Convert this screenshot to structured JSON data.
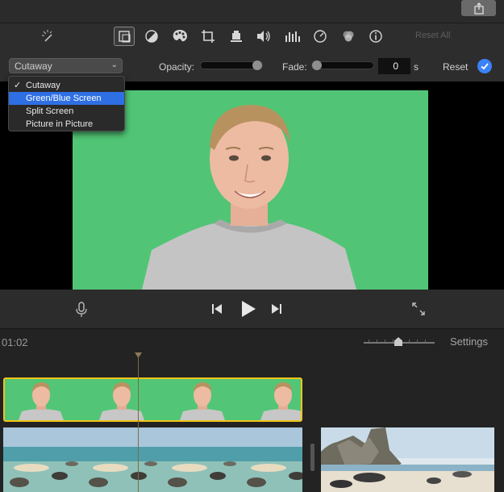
{
  "toolbar": {
    "tools": [
      "magic-wand-icon",
      "overlay-icon",
      "color-balance-icon",
      "color-palette-icon",
      "crop-icon",
      "stabilization-icon",
      "volume-icon",
      "equalizer-icon",
      "speed-icon",
      "filter-icon",
      "info-icon"
    ],
    "reset_all_label": "Reset All"
  },
  "overlay_controls": {
    "style_selected": "Cutaway",
    "opacity_label": "Opacity:",
    "opacity_level": 0.95,
    "fade_label": "Fade:",
    "fade_level": 0.0,
    "fade_value": "0",
    "fade_unit": "s",
    "reset_label": "Reset",
    "accent_color": "#3b82f6"
  },
  "style_menu": {
    "items": [
      {
        "label": "Cutaway",
        "checked": true,
        "highlighted": false
      },
      {
        "label": "Green/Blue Screen",
        "checked": false,
        "highlighted": true
      },
      {
        "label": "Split Screen",
        "checked": false,
        "highlighted": false
      },
      {
        "label": "Picture in Picture",
        "checked": false,
        "highlighted": false
      }
    ],
    "check_mark": "✓"
  },
  "timeline": {
    "timecode": "01:02",
    "settings_label": "Settings",
    "highlight_color": "#f0c419",
    "green_screen_color": "#51c575"
  }
}
